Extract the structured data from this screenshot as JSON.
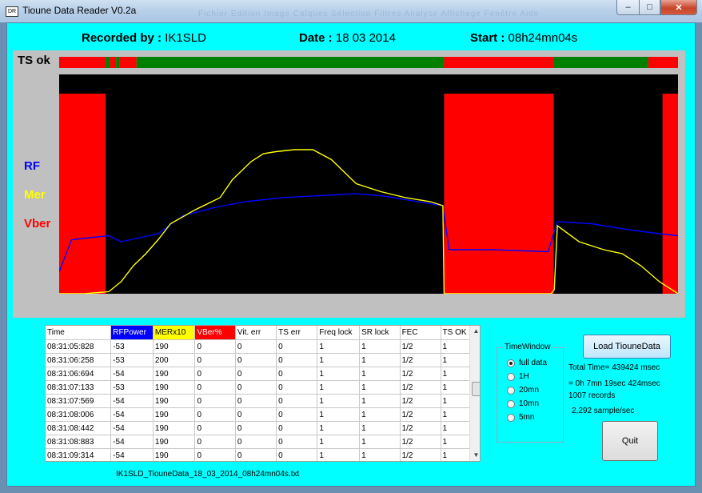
{
  "window": {
    "title": "Tioune Data Reader V0.2a",
    "ghost_menu": "Fichier   Edition   Image   Calques   Sélection   Filtres   Analyse   Affichage   Fenêtre   Aide"
  },
  "header": {
    "recorded_label": "Recorded by :",
    "recorded_value": "IK1SLD",
    "date_label": "Date :",
    "date_value": "18 03 2014",
    "start_label": "Start :",
    "start_value": "08h24mn04s"
  },
  "chart": {
    "tsok_label": "TS ok",
    "labels": {
      "rf": "RF",
      "mer": "Mer",
      "vber": "Vber"
    },
    "colors": {
      "rf": "#0000ff",
      "mer": "#ffff00",
      "vber": "#ff0000",
      "tsok": "#008000",
      "bg": "#000000"
    }
  },
  "chart_data": {
    "type": "line",
    "x_range": [
      0,
      100
    ],
    "ts_ok_segments": [
      {
        "from": 0,
        "to": 7.5,
        "ok": false
      },
      {
        "from": 7.5,
        "to": 8.2,
        "ok": true
      },
      {
        "from": 8.2,
        "to": 9.2,
        "ok": false
      },
      {
        "from": 9.2,
        "to": 9.7,
        "ok": true
      },
      {
        "from": 9.7,
        "to": 12.5,
        "ok": false
      },
      {
        "from": 12.5,
        "to": 62.2,
        "ok": true
      },
      {
        "from": 62.2,
        "to": 79.9,
        "ok": false
      },
      {
        "from": 79.9,
        "to": 95.2,
        "ok": true
      },
      {
        "from": 95.2,
        "to": 100,
        "ok": false
      }
    ],
    "vber_full_blocks": [
      {
        "from": 0,
        "to": 7.5
      },
      {
        "from": 62.2,
        "to": 79.9
      },
      {
        "from": 97.5,
        "to": 100
      }
    ],
    "series": [
      {
        "name": "RF",
        "points": [
          [
            0,
            89
          ],
          [
            2,
            73
          ],
          [
            5,
            72
          ],
          [
            8,
            71
          ],
          [
            10,
            74
          ],
          [
            13,
            72
          ],
          [
            16,
            70
          ],
          [
            20,
            61
          ],
          [
            25,
            57
          ],
          [
            30,
            54
          ],
          [
            36,
            52
          ],
          [
            42,
            51
          ],
          [
            48,
            50
          ],
          [
            52,
            51
          ],
          [
            56,
            53
          ],
          [
            60,
            55
          ],
          [
            62,
            56
          ],
          [
            63,
            78
          ],
          [
            70,
            78
          ],
          [
            79,
            79
          ],
          [
            80.5,
            64
          ],
          [
            86,
            65
          ],
          [
            92,
            68
          ],
          [
            97,
            70
          ],
          [
            100,
            71
          ]
        ]
      },
      {
        "name": "Mer",
        "points": [
          [
            0,
            100
          ],
          [
            4,
            100
          ],
          [
            8,
            99
          ],
          [
            10,
            94
          ],
          [
            12,
            86
          ],
          [
            14,
            80
          ],
          [
            16,
            73
          ],
          [
            18,
            65
          ],
          [
            22,
            58
          ],
          [
            26,
            52
          ],
          [
            28,
            43
          ],
          [
            31,
            34
          ],
          [
            33,
            30
          ],
          [
            35,
            29
          ],
          [
            38,
            28
          ],
          [
            41,
            28
          ],
          [
            44,
            33
          ],
          [
            48,
            45
          ],
          [
            52,
            49
          ],
          [
            56,
            52
          ],
          [
            60,
            54
          ],
          [
            62,
            56
          ],
          [
            62.2,
            100
          ],
          [
            79.5,
            100
          ],
          [
            80,
            98
          ],
          [
            80.5,
            66
          ],
          [
            84,
            74
          ],
          [
            88,
            78
          ],
          [
            91,
            80
          ],
          [
            94,
            86
          ],
          [
            97,
            94
          ],
          [
            100,
            100
          ]
        ]
      }
    ]
  },
  "table": {
    "columns": [
      "Time",
      "RFPower",
      "MERx10",
      "VBer%",
      "Vit. err",
      "TS err",
      "Freq lock",
      "SR lock",
      "FEC",
      "TS OK"
    ],
    "col_colors": [
      "#ffffff",
      "#0000ff",
      "#ffff00",
      "#ff0000",
      "#ffffff",
      "#ffffff",
      "#ffffff",
      "#ffffff",
      "#ffffff",
      "#ffffff"
    ],
    "rows": [
      [
        "08:31:05:828",
        "-53",
        "190",
        "0",
        "0",
        "0",
        "1",
        "1",
        "1/2",
        "1"
      ],
      [
        "08:31:06:258",
        "-53",
        "200",
        "0",
        "0",
        "0",
        "1",
        "1",
        "1/2",
        "1"
      ],
      [
        "08:31:06:694",
        "-54",
        "190",
        "0",
        "0",
        "0",
        "1",
        "1",
        "1/2",
        "1"
      ],
      [
        "08:31:07:133",
        "-53",
        "190",
        "0",
        "0",
        "0",
        "1",
        "1",
        "1/2",
        "1"
      ],
      [
        "08:31:07:569",
        "-54",
        "190",
        "0",
        "0",
        "0",
        "1",
        "1",
        "1/2",
        "1"
      ],
      [
        "08:31:08:006",
        "-54",
        "190",
        "0",
        "0",
        "0",
        "1",
        "1",
        "1/2",
        "1"
      ],
      [
        "08:31:08:442",
        "-54",
        "190",
        "0",
        "0",
        "0",
        "1",
        "1",
        "1/2",
        "1"
      ],
      [
        "08:31:08:883",
        "-54",
        "190",
        "0",
        "0",
        "0",
        "1",
        "1",
        "1/2",
        "1"
      ],
      [
        "08:31:09:314",
        "-54",
        "190",
        "0",
        "0",
        "0",
        "1",
        "1",
        "1/2",
        "1"
      ]
    ]
  },
  "filename": "IK1SLD_TiouneData_18_03_2014_08h24mn04s.txt",
  "time_window": {
    "legend": "TimeWindow",
    "options": [
      "full data",
      "1H",
      "20mn",
      "10mn",
      "5mn"
    ],
    "selected": "full data"
  },
  "buttons": {
    "load": "Load TiouneData",
    "quit": "Quit"
  },
  "stats": {
    "total_time": "Total Time= 439424 msec",
    "duration": "= 0h 7mn 19sec 424msec",
    "records": "1007 records",
    "rate": "2,292 sample/sec"
  }
}
